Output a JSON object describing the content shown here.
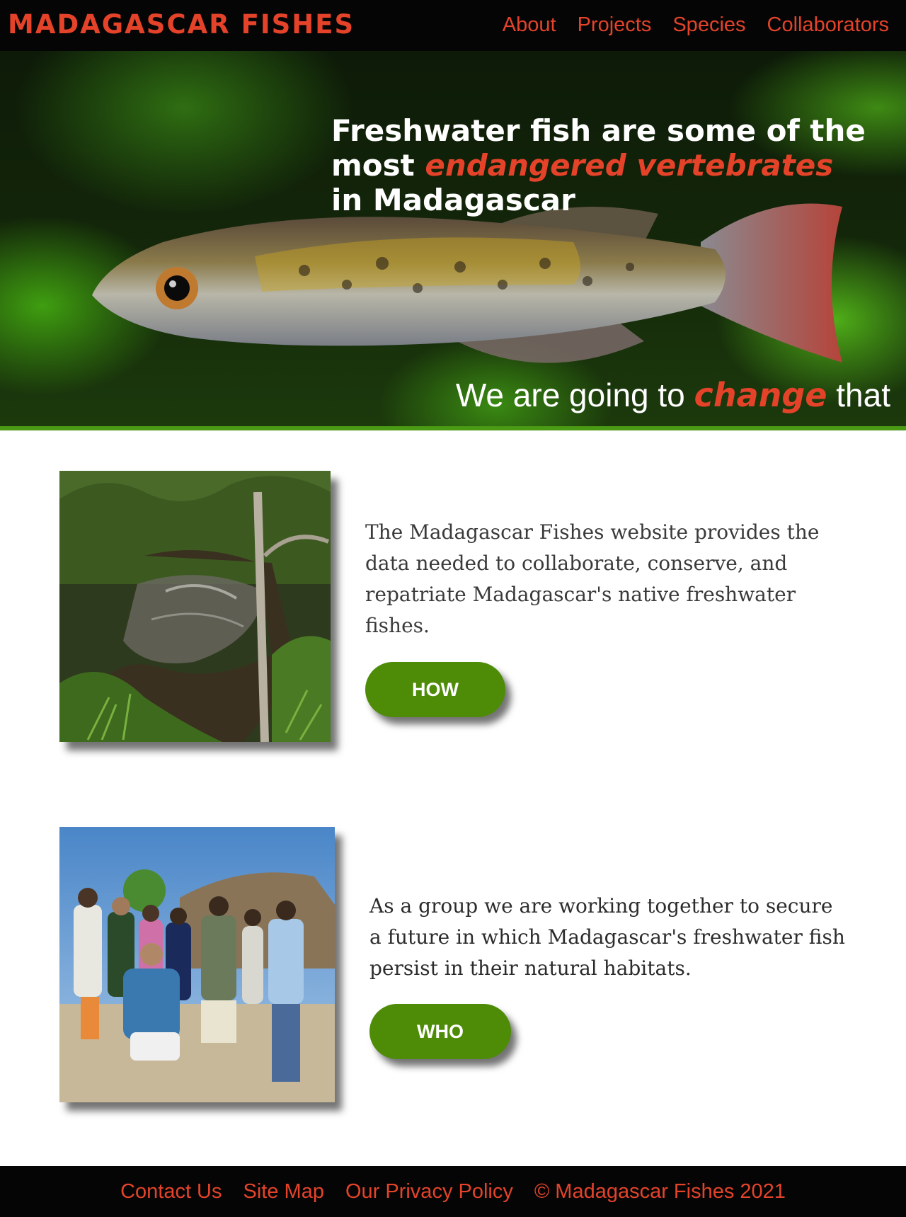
{
  "nav": {
    "brand": "MADAGASCAR FISHES",
    "links": [
      "About",
      "Projects",
      "Species",
      "Collaborators"
    ]
  },
  "hero": {
    "line1": "Freshwater fish are some of the",
    "line2_pre": "most ",
    "line2_em": "endangered vertebrates",
    "line3": "in Madagascar",
    "sub_pre": "We are going to ",
    "sub_em": "change",
    "sub_post": " that",
    "fish_image": "fish-photo"
  },
  "sections": [
    {
      "image": "stream-photo",
      "text": "The Madagascar Fishes website provides the data needed to collaborate, conserve, and repatriate Madagascar's native freshwater fishes.",
      "button": "HOW"
    },
    {
      "image": "group-photo",
      "text": "As a group we are working together to secure a future in which Madagascar's freshwater fish persist in their natural habitats.",
      "button": "WHO"
    }
  ],
  "footer": {
    "links": [
      "Contact Us",
      "Site Map",
      "Our Privacy Policy"
    ],
    "copyright": "© Madagascar Fishes 2021"
  },
  "colors": {
    "accent": "#e4432a",
    "button": "#4e8c08",
    "nav_bg": "#050505"
  }
}
